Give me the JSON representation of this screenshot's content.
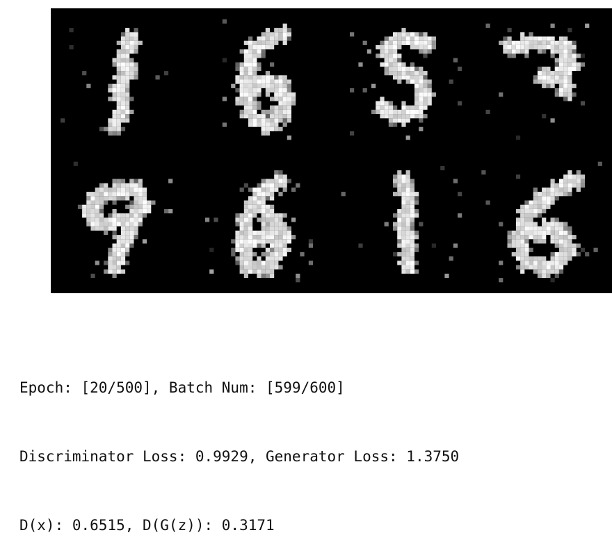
{
  "generated_samples": {
    "rows": 2,
    "cols": 4,
    "colors": {
      "background": "#000000",
      "stroke": "#ffffff"
    },
    "digits": [
      "1",
      "6",
      "5",
      "7",
      "9",
      "6",
      "1",
      "6"
    ]
  },
  "training_log": {
    "lines": [
      "Epoch: [20/500], Batch Num: [599/600]",
      "Discriminator Loss: 0.9929, Generator Loss: 1.3750",
      "D(x): 0.6515, D(G(z)): 0.3171"
    ]
  }
}
